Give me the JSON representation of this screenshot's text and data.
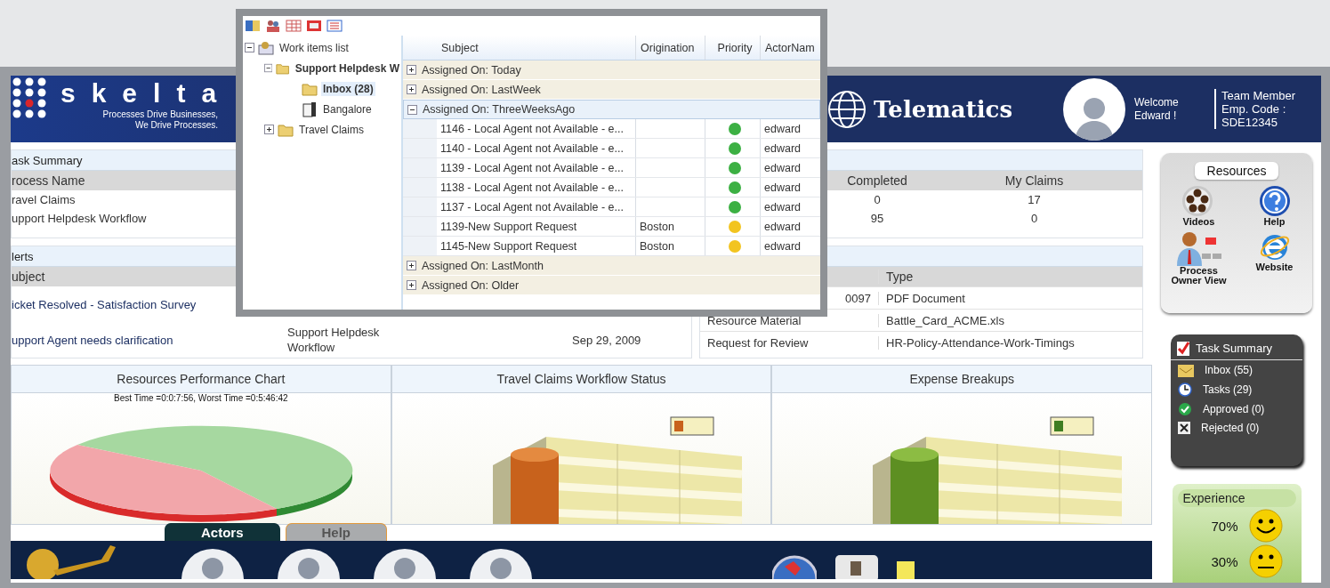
{
  "header": {
    "logo": "skelta",
    "tagline": [
      "Processes Drive Businesses,",
      "We Drive Processes."
    ],
    "company": "Telematics",
    "welcome": [
      "Welcome",
      "Edward !"
    ],
    "employee": [
      "Team Member",
      "Emp. Code :",
      "SDE12345"
    ]
  },
  "task_summary": {
    "title": "ask Summary",
    "columns": [
      "rocess Name",
      "Completed",
      "My Claims"
    ],
    "rows": [
      {
        "cells": [
          "ravel Claims",
          "0",
          "17"
        ]
      },
      {
        "cells": [
          "upport Helpdesk Workflow",
          "95",
          "0"
        ]
      }
    ]
  },
  "alerts": {
    "title": "lerts",
    "columns": [
      "ubject"
    ],
    "rows": [
      {
        "subject": "icket Resolved - Satisfaction Survey"
      },
      {
        "subject": "upport Agent needs clarification",
        "process": "Support Helpdesk Workflow",
        "date": "Sep 29, 2009"
      }
    ]
  },
  "documents": {
    "columns": [
      "Type"
    ],
    "rows": [
      {
        "name": "0097",
        "type": "PDF Document",
        "tail": true
      },
      {
        "name": "Resource Material",
        "type": "Battle_Card_ACME.xls",
        "tail": false
      },
      {
        "name": "Request for Review",
        "type": "HR-Policy-Attendance-Work-Timings",
        "tail": false
      }
    ]
  },
  "charts": [
    {
      "title": "Resources Performance Chart",
      "kind": "pie",
      "caption": "Best Time =0:0:7:56, Worst Time =0:5:46:42"
    },
    {
      "title": "Travel Claims Workflow Status",
      "kind": "orange-column"
    },
    {
      "title": "Expense Breakups",
      "kind": "green-column"
    }
  ],
  "tabs": [
    {
      "label": "Actors",
      "selected": true
    },
    {
      "label": "Help",
      "selected": false
    }
  ],
  "resources": {
    "title": "Resources",
    "items": [
      {
        "label": "Videos",
        "kind": "film"
      },
      {
        "label": "Help",
        "kind": "help"
      },
      {
        "label": "Process Owner View",
        "kind": "owner"
      },
      {
        "label": "Website",
        "kind": "browser"
      }
    ]
  },
  "task_panel": {
    "title": "Task Summary",
    "items": [
      {
        "label": "Inbox (55)",
        "kind": "inbox"
      },
      {
        "label": "Tasks (29)",
        "kind": "clock"
      },
      {
        "label": "Approved (0)",
        "kind": "approved"
      },
      {
        "label": "Rejected (0)",
        "kind": "rejected"
      }
    ]
  },
  "experience": {
    "title": "Experience",
    "rows": [
      {
        "percent": "70%",
        "kind": "happy"
      },
      {
        "percent": "30%",
        "kind": "neutral"
      }
    ]
  },
  "window": {
    "tree": [
      {
        "label": "Work items list",
        "kind": "root",
        "expanded": true,
        "bold": false,
        "selected": false,
        "children": [
          {
            "label": "Support Helpdesk W",
            "kind": "folder",
            "expanded": true,
            "bold": true,
            "selected": false,
            "children": [
              {
                "label": "Inbox (28)",
                "kind": "folder",
                "bold": true,
                "selected": true
              },
              {
                "label": "Bangalore",
                "kind": "book",
                "bold": false,
                "selected": false
              }
            ]
          },
          {
            "label": "Travel Claims",
            "kind": "folder",
            "expanded": false,
            "bold": false,
            "selected": false
          }
        ]
      }
    ],
    "columns": [
      "Subject",
      "Origination",
      "Priority",
      "ActorNam"
    ],
    "groups": [
      {
        "label": "Assigned On: Today",
        "expanded": false
      },
      {
        "label": "Assigned On: LastWeek",
        "expanded": false
      },
      {
        "label": "Assigned On: ThreeWeeksAgo",
        "expanded": true,
        "rows": [
          {
            "subject": "1146 - Local Agent not Available - e...",
            "color": "#3cb043",
            "actor": "edward"
          },
          {
            "subject": "1140 - Local Agent not Available - e...",
            "color": "#3cb043",
            "actor": "edward"
          },
          {
            "subject": "1139 - Local Agent not Available - e...",
            "color": "#3cb043",
            "actor": "edward"
          },
          {
            "subject": "1138 - Local Agent not Available - e...",
            "color": "#3cb043",
            "actor": "edward"
          },
          {
            "subject": "1137 - Local Agent not Available - e...",
            "color": "#3cb043",
            "actor": "edward"
          },
          {
            "subject": "1139-New Support Request",
            "origination": "Boston",
            "color": "#f2c420",
            "actor": "edward"
          },
          {
            "subject": "1145-New Support Request",
            "origination": "Boston",
            "color": "#f2c420",
            "actor": "edward"
          }
        ]
      },
      {
        "label": "Assigned On: LastMonth",
        "expanded": false
      },
      {
        "label": "Assigned On: Older",
        "expanded": false
      }
    ]
  }
}
